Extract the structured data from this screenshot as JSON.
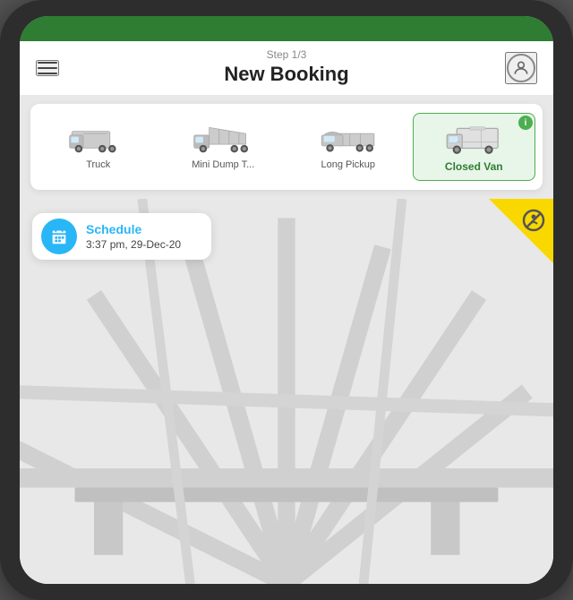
{
  "header": {
    "step_label": "Step 1/3",
    "title": "New Booking"
  },
  "vehicles": [
    {
      "id": "truck",
      "label": "Truck",
      "active": false
    },
    {
      "id": "mini-dump",
      "label": "Mini Dump T...",
      "active": false
    },
    {
      "id": "long-pickup",
      "label": "Long Pickup",
      "active": false
    },
    {
      "id": "closed-van",
      "label": "Closed Van",
      "active": true
    }
  ],
  "schedule": {
    "label": "Schedule",
    "time": "3:37 pm, 29-Dec-20"
  },
  "icons": {
    "info": "i",
    "calendar": "📅",
    "profile": "👤",
    "map_pin": "📍"
  },
  "colors": {
    "green_dark": "#2e7d32",
    "green_light": "#4caf50",
    "blue": "#29b6f6",
    "yellow": "#f9d800"
  }
}
